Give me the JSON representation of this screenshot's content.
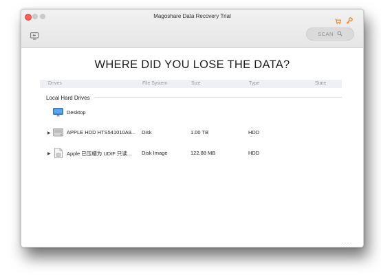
{
  "window": {
    "title": "Magoshare Data Recovery Trial"
  },
  "toolbar": {
    "scan_label": "SCAN",
    "scan_icon": "search-icon",
    "back_icon": "back-screen-icon",
    "cart_icon": "cart-icon",
    "key_icon": "key-icon"
  },
  "main": {
    "heading": "WHERE DID YOU LOSE THE DATA?",
    "columns": [
      "Drives",
      "File System",
      "Size",
      "Type",
      "State"
    ],
    "section_label": "Local Hard Drives",
    "rows": [
      {
        "name": "Desktop",
        "file_system": "",
        "size": "",
        "type": "",
        "state": "",
        "icon": "monitor-icon",
        "expandable": false
      },
      {
        "name": "APPLE HDD HTS541010A9...",
        "file_system": "Disk",
        "size": "1.00 TB",
        "type": "HDD",
        "state": "",
        "icon": "hard-drive-icon",
        "expandable": true
      },
      {
        "name": "Apple 已压缩为 UDIF 只读...",
        "file_system": "Disk Image",
        "size": "122.88 MB",
        "type": "HDD",
        "state": "",
        "icon": "disk-image-icon",
        "expandable": true
      }
    ]
  },
  "colors": {
    "accent_orange": "#f0871c",
    "close_red": "#fd5f57",
    "monitor_blue": "#2f7fd8"
  }
}
